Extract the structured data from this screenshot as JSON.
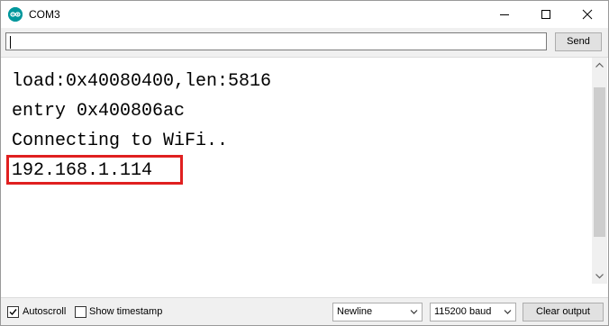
{
  "window": {
    "title": "COM3",
    "app_icon": "arduino-icon",
    "controls": [
      "minimize-icon",
      "maximize-icon",
      "close-icon"
    ]
  },
  "input": {
    "value": "",
    "send_label": "Send"
  },
  "output": {
    "lines": [
      "load:0x40080400,len:5816",
      "entry 0x400806ac",
      "Connecting to WiFi..",
      "192.168.1.114"
    ],
    "highlight_color": "#e02020"
  },
  "footer": {
    "autoscroll_label": "Autoscroll",
    "autoscroll_checked": true,
    "timestamp_label": "Show timestamp",
    "timestamp_checked": false,
    "line_ending": "Newline",
    "baud_rate": "115200 baud",
    "clear_label": "Clear output"
  },
  "colors": {
    "accent": "#00979c",
    "button_bg": "#e1e1e1",
    "window_bg": "#f0f0f0"
  }
}
